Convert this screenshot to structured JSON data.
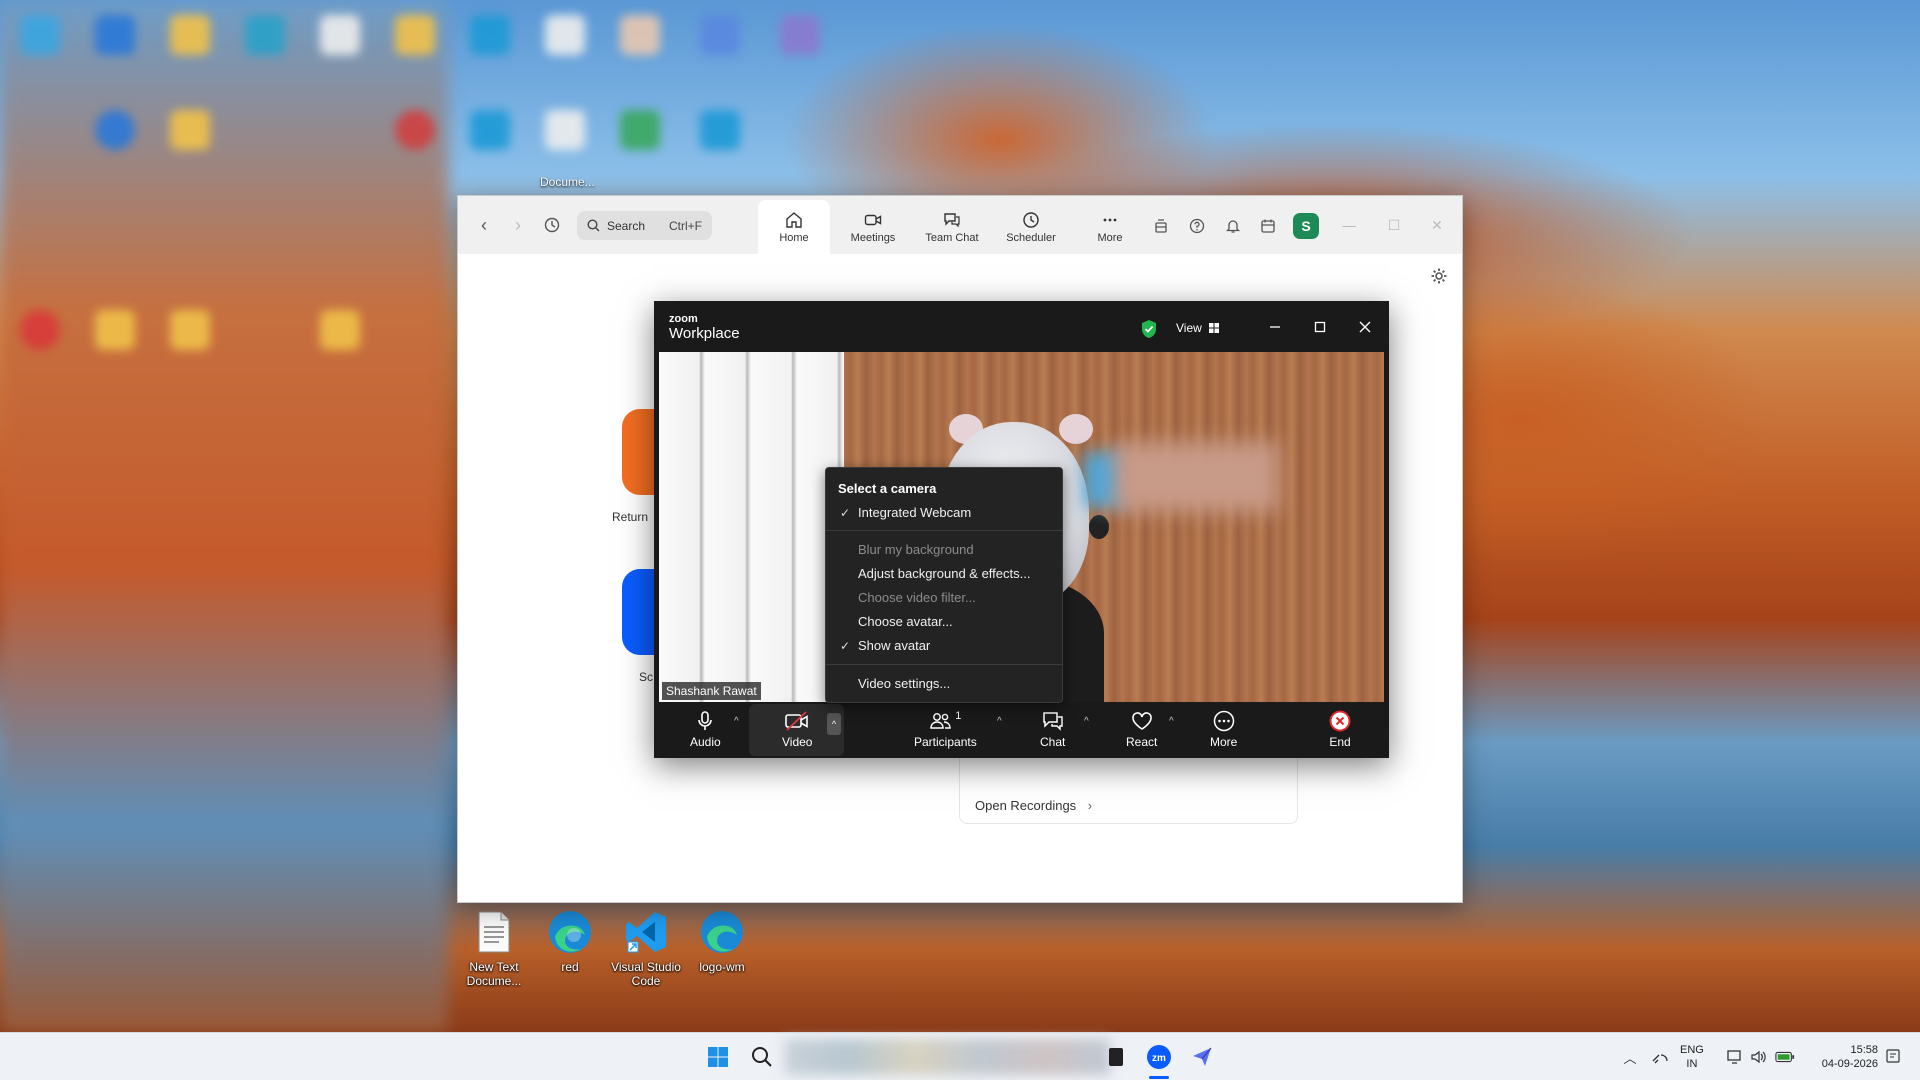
{
  "desktop": {
    "icons": [
      {
        "label": "New Text Docume..."
      },
      {
        "label": "red"
      },
      {
        "label": "Visual Studio Code"
      },
      {
        "label": "logo-wm"
      }
    ],
    "top_label": "Docume..."
  },
  "zoom_main": {
    "search": {
      "placeholder": "Search",
      "shortcut": "Ctrl+F"
    },
    "tabs": [
      {
        "label": "Home",
        "icon": "home-icon"
      },
      {
        "label": "Meetings",
        "icon": "video-icon"
      },
      {
        "label": "Team Chat",
        "icon": "chat-icon"
      },
      {
        "label": "Scheduler",
        "icon": "clock-icon"
      },
      {
        "label": "More",
        "icon": "more-icon"
      }
    ],
    "profile_initial": "S",
    "home": {
      "return_label": "Return",
      "sc_label": "Sc",
      "open_recordings": "Open Recordings",
      "colors": {
        "orange_button": "#f26d21",
        "blue_button": "#0b5cff"
      }
    }
  },
  "meeting": {
    "brand_small": "zoom",
    "brand_big": "Workplace",
    "view_label": "View",
    "participant_name": "Shashank Rawat",
    "toolbar": {
      "audio": "Audio",
      "video": "Video",
      "participants": "Participants",
      "participants_count": "1",
      "chat": "Chat",
      "react": "React",
      "more": "More",
      "end": "End"
    },
    "camera_menu": {
      "heading": "Select a camera",
      "camera": "Integrated Webcam",
      "blur": "Blur my background",
      "adjust": "Adjust background & effects...",
      "filter": "Choose video filter...",
      "avatar": "Choose avatar...",
      "show_avatar": "Show avatar",
      "settings": "Video settings..."
    }
  },
  "taskbar": {
    "lang_top": "ENG",
    "lang_bottom": "IN",
    "time": "15:58",
    "date": "04-09-2026"
  }
}
